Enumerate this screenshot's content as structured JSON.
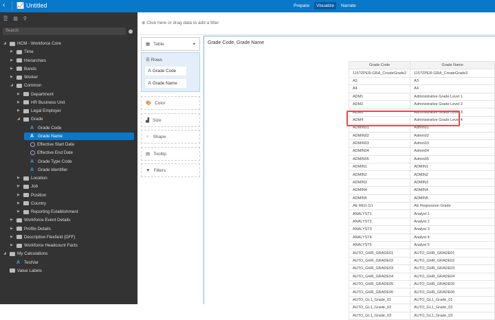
{
  "header": {
    "title": "Untitled",
    "modes": [
      "Prepare",
      "Visualize",
      "Narrate"
    ],
    "active_mode": "Visualize"
  },
  "left": {
    "search_placeholder": "Search",
    "tree": [
      {
        "label": "HCM - Workforce Core",
        "level": 0,
        "type": "subject",
        "tw": "◢"
      },
      {
        "label": "Time",
        "level": 1,
        "type": "folder",
        "tw": "▶"
      },
      {
        "label": "Hierarchies",
        "level": 1,
        "type": "folder",
        "tw": "▶"
      },
      {
        "label": "Bands",
        "level": 1,
        "type": "folder",
        "tw": "▶"
      },
      {
        "label": "Worker",
        "level": 1,
        "type": "folder",
        "tw": "▶"
      },
      {
        "label": "Common",
        "level": 1,
        "type": "folder",
        "tw": "◢"
      },
      {
        "label": "Department",
        "level": 2,
        "type": "folder",
        "tw": "▶"
      },
      {
        "label": "HR Business Unit",
        "level": 2,
        "type": "folder",
        "tw": "▶"
      },
      {
        "label": "Legal Employer",
        "level": 2,
        "type": "folder",
        "tw": "▶"
      },
      {
        "label": "Grade",
        "level": 2,
        "type": "folder",
        "tw": "◢"
      },
      {
        "label": "Grade Code",
        "level": 3,
        "type": "attr"
      },
      {
        "label": "Grade Name",
        "level": 3,
        "type": "attr",
        "selected": true
      },
      {
        "label": "Effective Start Date",
        "level": 3,
        "type": "date"
      },
      {
        "label": "Effective End Date",
        "level": 3,
        "type": "date"
      },
      {
        "label": "Grade Type Code",
        "level": 3,
        "type": "attr"
      },
      {
        "label": "Grade Identifier",
        "level": 3,
        "type": "attr"
      },
      {
        "label": "Location",
        "level": 2,
        "type": "folder",
        "tw": "▶"
      },
      {
        "label": "Job",
        "level": 2,
        "type": "folder",
        "tw": "▶"
      },
      {
        "label": "Position",
        "level": 2,
        "type": "folder",
        "tw": "▶"
      },
      {
        "label": "Country",
        "level": 2,
        "type": "folder",
        "tw": "▶"
      },
      {
        "label": "Reporting Establishment",
        "level": 2,
        "type": "folder",
        "tw": "▶"
      },
      {
        "label": "Workforce Event Details",
        "level": 1,
        "type": "folder",
        "tw": "▶"
      },
      {
        "label": "Profile Details",
        "level": 1,
        "type": "folder",
        "tw": "▶"
      },
      {
        "label": "Descriptive Flexfield (DFF)",
        "level": 1,
        "type": "folder",
        "tw": "▶"
      },
      {
        "label": "Workforce Headcount Facts",
        "level": 1,
        "type": "folder",
        "tw": "▶"
      },
      {
        "label": "My Calculations",
        "level": 0,
        "type": "folder",
        "tw": "◢"
      },
      {
        "label": "TestVar",
        "level": 1,
        "type": "attr"
      },
      {
        "label": "Value Labels",
        "level": 0,
        "type": "tag"
      }
    ]
  },
  "filter_bar": {
    "text": "Click here or drag data to add a filter"
  },
  "grammar": {
    "viz_type": "Table",
    "rows_label": "Rows",
    "rows": [
      "Grade Code",
      "Grade Name"
    ],
    "color": "Color",
    "size": "Size",
    "shape": "Shape",
    "tooltip": "Tooltip",
    "filters": "Filters"
  },
  "canvas": {
    "title": "Grade Code, Grade Name",
    "columns": [
      "Grade Code",
      "Grade Name"
    ],
    "rows": [
      [
        "115?ZPER-GRA_CreateGrade2",
        "115?ZPER-GRA_CreateGrade2"
      ],
      [
        "A3",
        "A3"
      ],
      [
        "A4",
        "A4"
      ],
      [
        "ADM1",
        "Administrative Grade Level 1"
      ],
      [
        "ADM2",
        "Administrative Grade Level 2"
      ],
      [
        "ADM3",
        "Administrative Grade Level 3"
      ],
      [
        "ADM4",
        "Administrative Grade Level 4"
      ],
      [
        "ADMIN01",
        "Admin01"
      ],
      [
        "ADMIN02",
        "Admin02"
      ],
      [
        "ADMIN03",
        "Admin03"
      ],
      [
        "ADMIN04",
        "Admin04"
      ],
      [
        "ADMIN05",
        "Admin05"
      ],
      [
        "ADMIN1",
        "ADMIN1"
      ],
      [
        "ADMIN2",
        "ADMIN2"
      ],
      [
        "ADMIN3",
        "ADMIN3"
      ],
      [
        "ADMIN4",
        "ADMIN4"
      ],
      [
        "ADMIN5",
        "ADMIN5"
      ],
      [
        "AE REG G1",
        "AE Regression Grade"
      ],
      [
        "ANALYST1",
        "Analyst 1"
      ],
      [
        "ANALYST2",
        "Analyst 2"
      ],
      [
        "ANALYST3",
        "Analyst 3"
      ],
      [
        "ANALYST4",
        "Analyst 4"
      ],
      [
        "ANALYST5",
        "Analyst 5"
      ],
      [
        "AUTO_GHR_GRADE01",
        "AUTO_GHR_GRADE01"
      ],
      [
        "AUTO_GHR_GRADE02",
        "AUTO_GHR_GRADE02"
      ],
      [
        "AUTO_GHR_GRADE03",
        "AUTO_GHR_GRADE03"
      ],
      [
        "AUTO_GHR_GRADE04",
        "AUTO_GHR_GRADE04"
      ],
      [
        "AUTO_GHR_GRADE05",
        "AUTO_GHR_GRADE05"
      ],
      [
        "AUTO_GHR_GRADE06",
        "AUTO_GHR_GRADE06"
      ],
      [
        "AUTO_GL1_Grade_01",
        "AUTO_GL1_Grade_01"
      ],
      [
        "AUTO_GL1_Grade_02",
        "AUTO_GL1_Grade_02"
      ],
      [
        "AUTO_GL1_Grade_03",
        "AUTO_GL1_Grade_03"
      ]
    ]
  }
}
